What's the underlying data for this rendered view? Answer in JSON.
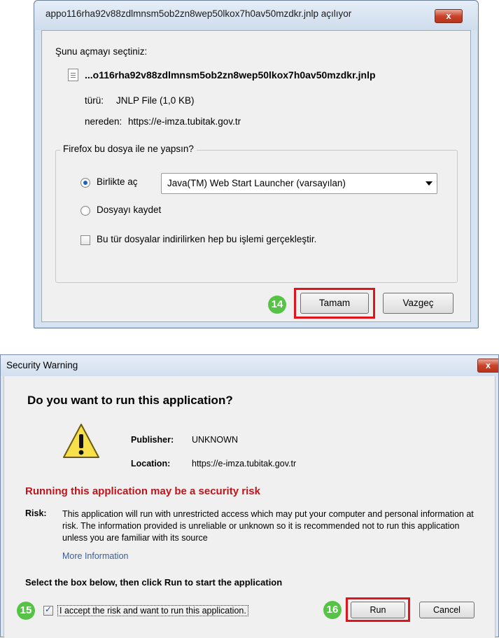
{
  "firefox_dialog": {
    "title": "appo116rha92v88zdlmnsm5ob2zn8wep50lkox7h0av50mzdkr.jnlp açılıyor",
    "close_glyph": "x",
    "prompt": "Şunu açmayı seçtiniz:",
    "file_name": "...o116rha92v88zdlmnsm5ob2zn8wep50lkox7h0av50mzdkr.jnlp",
    "type_label": "türü:",
    "type_value": "JNLP File (1,0 KB)",
    "from_label": "nereden:",
    "from_value": "https://e-imza.tubitak.gov.tr",
    "group_title": "Firefox bu dosya ile ne yapsın?",
    "open_with_label": "Birlikte aç",
    "open_with_selected": true,
    "open_with_app": "Java(TM) Web Start Launcher (varsayılan)",
    "save_file_label": "Dosyayı kaydet",
    "save_file_selected": false,
    "always_do_label": "Bu tür dosyalar indirilirken hep bu işlemi gerçekleştir.",
    "always_do_checked": false,
    "ok_label": "Tamam",
    "cancel_label": "Vazgeç",
    "step_ok": "14"
  },
  "security_warning": {
    "title": "Security Warning",
    "close_glyph": "x",
    "heading": "Do you want to run this application?",
    "publisher_label": "Publisher:",
    "publisher_value": "UNKNOWN",
    "location_label": "Location:",
    "location_value": "https://e-imza.tubitak.gov.tr",
    "risk_heading": "Running this application may be a security risk",
    "risk_label": "Risk:",
    "risk_text": "This application will run with unrestricted access which may put your computer and personal information at risk. The information provided is unreliable or unknown so it is recommended not to run this application unless you are familiar with its source",
    "more_info_label": "More Information",
    "instruction": "Select the box below, then click Run to start the application",
    "accept_label": "I accept the risk and want to run this application.",
    "accept_checked": true,
    "run_label": "Run",
    "cancel_label": "Cancel",
    "step_accept": "15",
    "step_run": "16"
  },
  "colors": {
    "highlight_red": "#e0141b",
    "step_badge_green": "#57c346",
    "risk_red": "#c0141b",
    "link_blue": "#3a5e9a"
  }
}
